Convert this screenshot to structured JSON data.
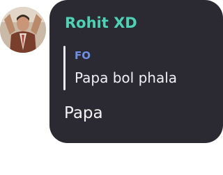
{
  "chat": {
    "message": {
      "sender_name": "Rohit XD",
      "reply": {
        "author": "FO",
        "text": "Papa bol phala"
      },
      "text": "Papa"
    }
  },
  "colors": {
    "bubble_bg": "#2b2a33",
    "sender_name": "#4fd1b5",
    "reply_author": "#6f8fe8",
    "reply_bar": "#e9e9ee",
    "message_text": "#f4f4f6"
  }
}
